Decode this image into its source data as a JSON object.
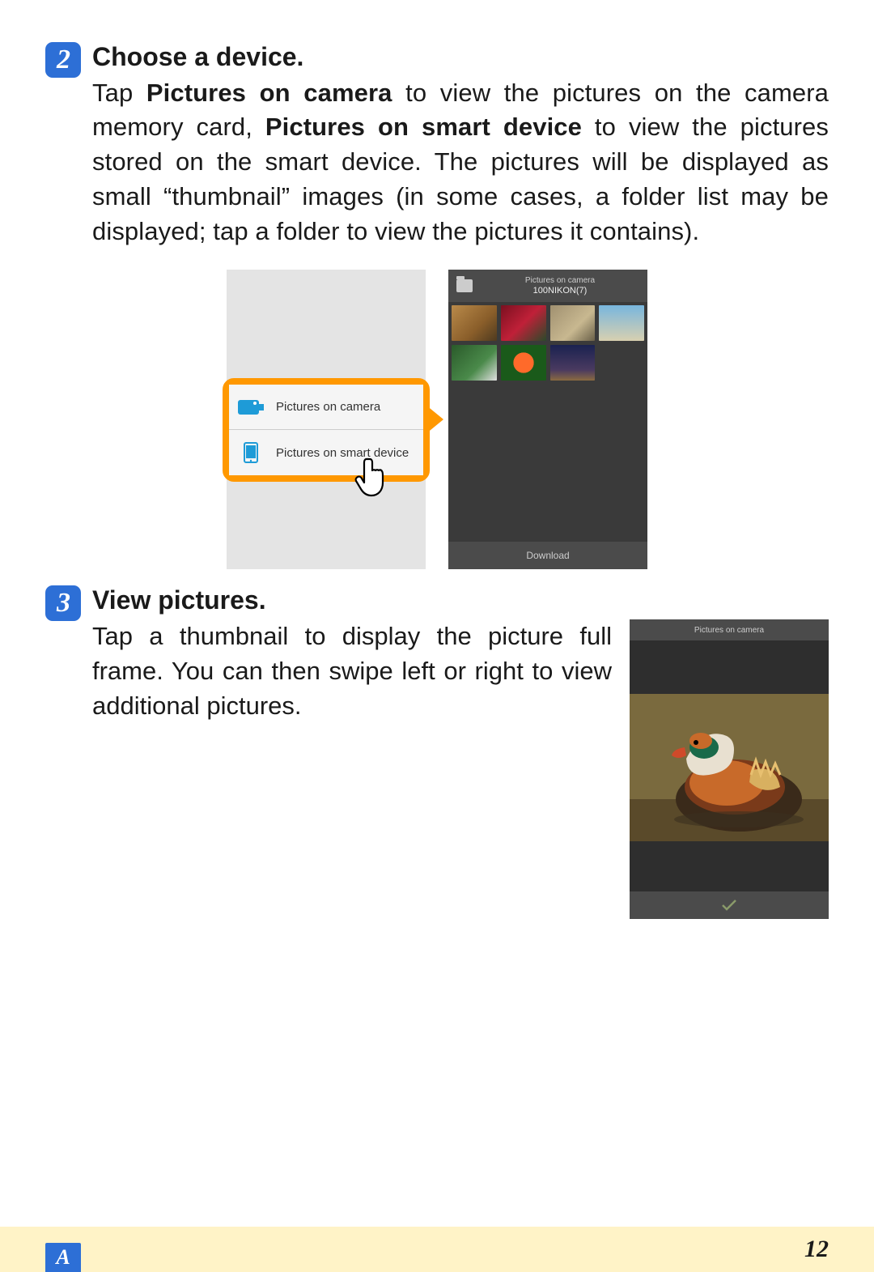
{
  "step2": {
    "num": "2",
    "title": "Choose a device.",
    "body_parts": {
      "t1": "Tap ",
      "b1": "Pictures on camera",
      "t2": " to view the pictures on the camera memory card, ",
      "b2": "Pictures on smart device",
      "t3": " to view the pictures stored on the smart device. The pictures will be displayed as small “thumbnail” images (in some cases, a folder list may be displayed; tap a folder to view the pictures it contains)."
    }
  },
  "phone_left": {
    "menu": {
      "camera_label": "Pictures on camera",
      "smart_label": "Pictures on smart device"
    }
  },
  "phone_right": {
    "header_line1": "Pictures on camera",
    "header_line2": "100NIKON(7)",
    "download_label": "Download",
    "thumbs": [
      {
        "bg": "linear-gradient(135deg,#b98a4a,#8a5e2a 60%,#4e3a1f)"
      },
      {
        "bg": "linear-gradient(135deg,#7a1020,#c02038 50%,#2a4a2a)"
      },
      {
        "bg": "linear-gradient(135deg,#a09070,#c8b890 60%,#6a6048)"
      },
      {
        "bg": "linear-gradient(180deg,#78b6de,#d8d0b0)"
      },
      {
        "bg": "linear-gradient(135deg,#2a5a2a,#4a8a4a 60%,#e0e0e0)"
      },
      {
        "bg": "radial-gradient(circle at 50% 50%,#ff6a2a 0,#ff6a2a 35%,#1a5a1a 36%,#1a5a1a 100%)"
      },
      {
        "bg": "linear-gradient(180deg,#1a2250,#4a3a60 70%,#8a6a40)"
      }
    ]
  },
  "step3": {
    "num": "3",
    "title": "View pictures.",
    "body": "Tap a thumbnail to display the picture full frame. You can then swipe left or right to view additional pictures."
  },
  "phone3": {
    "header": "Pictures on camera"
  },
  "footer": {
    "section": "A",
    "page": "12"
  },
  "colors": {
    "accent": "#2d6fd6",
    "highlight": "#ff9800"
  }
}
